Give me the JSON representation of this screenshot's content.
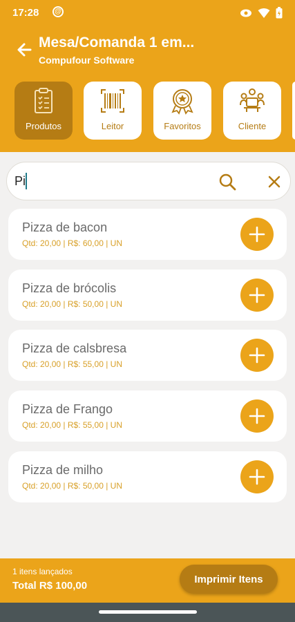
{
  "status_bar": {
    "time": "17:28",
    "notification_glyph": "@"
  },
  "header": {
    "title": "Mesa/Comanda 1 em...",
    "subtitle": "Compufour Software",
    "background_color": "#eba41a"
  },
  "tabs": [
    {
      "label": "Produtos",
      "icon": "clipboard-list-icon",
      "active": true
    },
    {
      "label": "Leitor",
      "icon": "barcode-icon",
      "active": false
    },
    {
      "label": "Favoritos",
      "icon": "award-star-icon",
      "active": false
    },
    {
      "label": "Cliente",
      "icon": "people-table-icon",
      "active": false
    }
  ],
  "search": {
    "value": "Pi",
    "placeholder": ""
  },
  "products": [
    {
      "name": "Pizza de bacon",
      "detail": "Qtd: 20,00  | R$: 60,00 | UN"
    },
    {
      "name": "Pizza de brócolis",
      "detail": "Qtd: 20,00  | R$: 50,00 | UN"
    },
    {
      "name": "Pizza de calsbresa",
      "detail": "Qtd: 20,00  | R$: 55,00 | UN"
    },
    {
      "name": "Pizza de Frango",
      "detail": "Qtd: 20,00  | R$: 55,00 | UN"
    },
    {
      "name": "Pizza de milho",
      "detail": "Qtd: 20,00  | R$: 50,00 | UN"
    }
  ],
  "footer": {
    "items_count": "1 itens lançados",
    "total": "Total R$ 100,00",
    "print_label": "Imprimir Itens"
  },
  "colors": {
    "accent": "#eba41a",
    "accent_dark": "#b57c14",
    "background": "#f2f1f0"
  }
}
